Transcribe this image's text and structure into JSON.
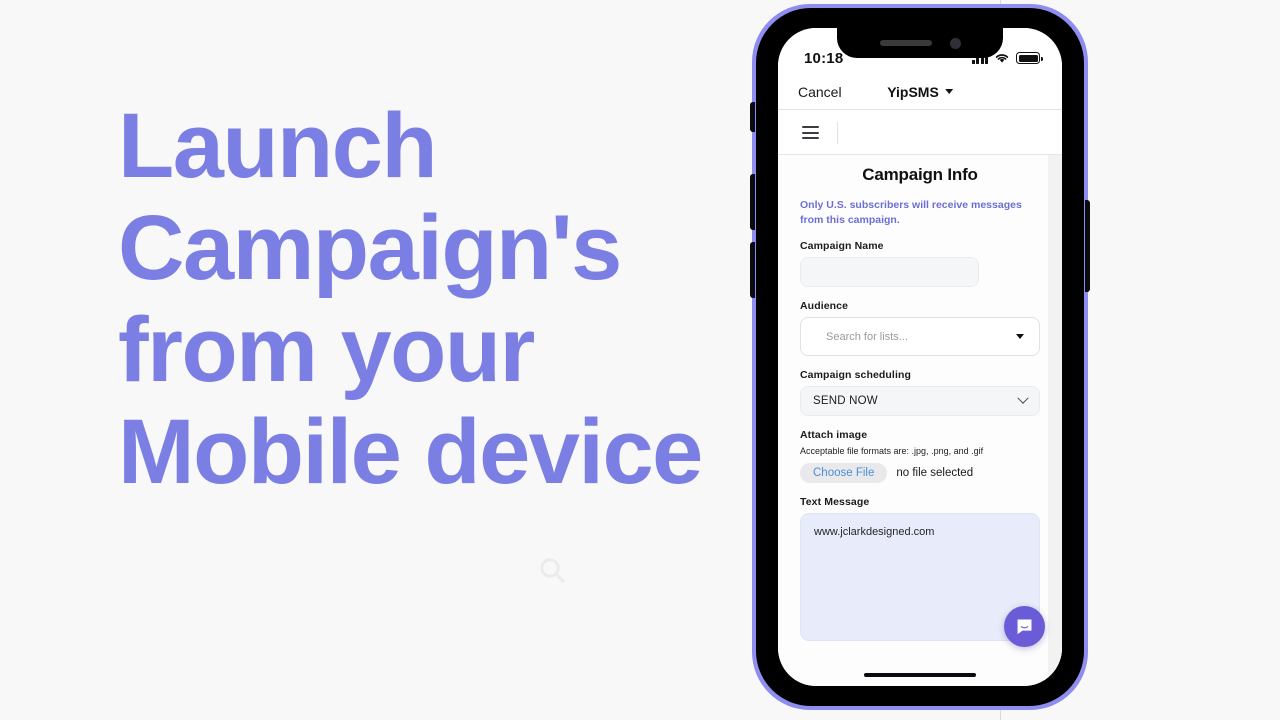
{
  "background_color": "#f8f8f8",
  "accent_color": "#7b7fe3",
  "hero": {
    "lines": [
      "Launch",
      "Campaign's",
      "from your",
      "Mobile device"
    ],
    "search_watermark_icon": "search-icon"
  },
  "phone": {
    "frame_color": "#8e8df0",
    "status_bar": {
      "time": "10:18",
      "signal_icon": "cellular-signal-icon",
      "wifi_icon": "wifi-icon",
      "battery_icon": "battery-icon"
    },
    "browser_nav": {
      "cancel_label": "Cancel",
      "site_title": "YipSMS",
      "dropdown_icon": "chevron-down-icon"
    },
    "app_header": {
      "menu_icon": "hamburger-menu-icon"
    },
    "form": {
      "page_title": "Campaign Info",
      "notice": "Only U.S. subscribers will receive messages from this campaign.",
      "notice_color": "#6b6fd4",
      "campaign_name": {
        "label": "Campaign Name",
        "value": "",
        "placeholder": ""
      },
      "audience": {
        "label": "Audience",
        "placeholder": "Search for lists...",
        "value": "",
        "dropdown_icon": "caret-down-icon"
      },
      "scheduling": {
        "label": "Campaign scheduling",
        "selected": "SEND NOW",
        "chevron_icon": "chevron-down-icon"
      },
      "attach_image": {
        "label": "Attach image",
        "hint": "Acceptable file formats are: .jpg, .png, and .gif",
        "choose_file_label": "Choose File",
        "file_status": "no file selected"
      },
      "text_message": {
        "label": "Text Message",
        "value": "www.jclarkdesigned.com"
      }
    },
    "chat_widget": {
      "icon": "chat-bubble-icon",
      "color": "#6a5cd6"
    },
    "home_indicator": "home-indicator"
  }
}
